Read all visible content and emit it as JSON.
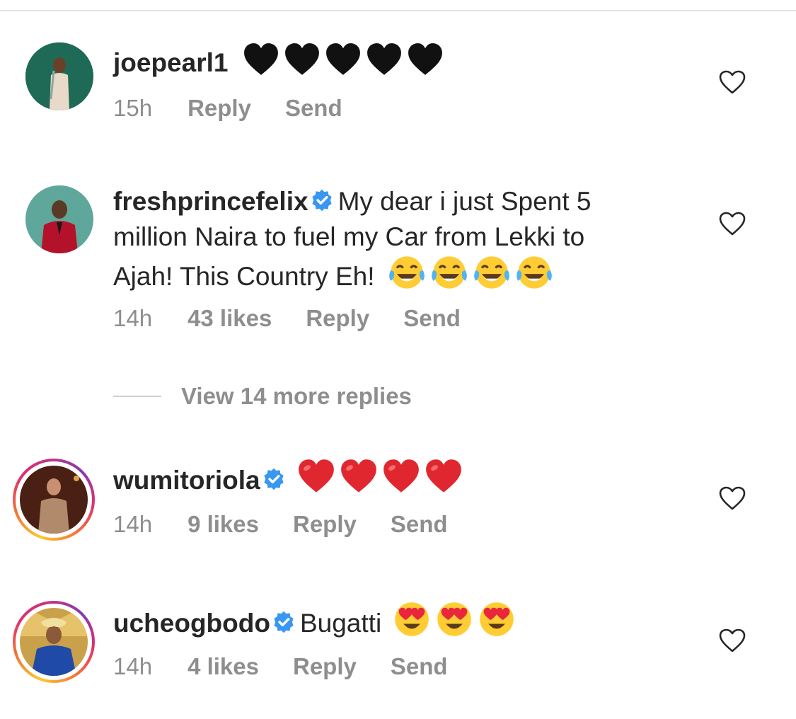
{
  "comments": [
    {
      "username": "joepearl1",
      "verified": false,
      "emojis": [
        "black-heart",
        "black-heart",
        "black-heart",
        "black-heart",
        "black-heart"
      ],
      "time": "15h",
      "reply_label": "Reply",
      "send_label": "Send"
    },
    {
      "username": "freshprincefelix",
      "verified": true,
      "text_line1": "My dear i just Spent 5",
      "text_line2": "million Naira to fuel my Car from Lekki to",
      "text_line3": "Ajah! This Country Eh!",
      "emojis": [
        "tears-of-joy",
        "tears-of-joy",
        "tears-of-joy",
        "tears-of-joy"
      ],
      "time": "14h",
      "likes": "43 likes",
      "reply_label": "Reply",
      "send_label": "Send"
    },
    {
      "username": "wumitoriola",
      "verified": true,
      "has_story_ring": true,
      "emojis": [
        "red-heart",
        "red-heart",
        "red-heart",
        "red-heart"
      ],
      "time": "14h",
      "likes": "9 likes",
      "reply_label": "Reply",
      "send_label": "Send"
    },
    {
      "username": "ucheogbodo",
      "verified": true,
      "has_story_ring": true,
      "text": "Bugatti",
      "emojis": [
        "heart-eyes",
        "heart-eyes",
        "heart-eyes"
      ],
      "time": "14h",
      "likes": "4 likes",
      "reply_label": "Reply",
      "send_label": "Send"
    }
  ],
  "view_more_replies": "View 14 more replies",
  "colors": {
    "verified": "#3897f0",
    "secondary_text": "#8e8e8e",
    "primary_text": "#262626"
  }
}
